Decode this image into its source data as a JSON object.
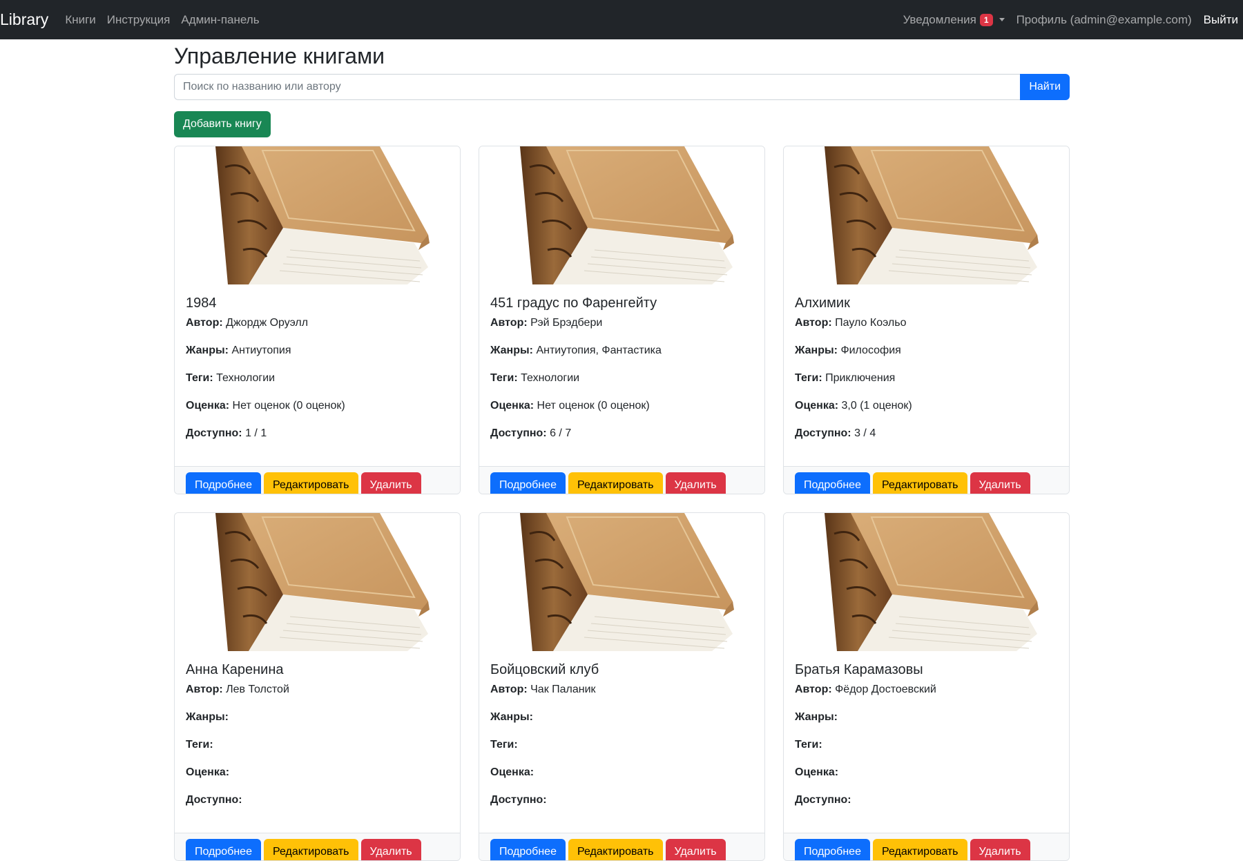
{
  "nav": {
    "brand": "Library",
    "links": [
      "Книги",
      "Инструкция",
      "Админ-панель"
    ],
    "notifications_label": "Уведомления",
    "notifications_count": "1",
    "profile": "Профиль (admin@example.com)",
    "logout": "Выйти"
  },
  "page": {
    "title": "Управление книгами",
    "search_placeholder": "Поиск по названию или автору",
    "search_button": "Найти",
    "add_button": "Добавить книгу"
  },
  "labels": {
    "author": "Автор:",
    "genres": "Жанры:",
    "tags": "Теги:",
    "rating": "Оценка:",
    "available": "Доступно:",
    "details": "Подробнее",
    "edit": "Редактировать",
    "delete": "Удалить"
  },
  "books": [
    {
      "title": "1984",
      "author": "Джордж Оруэлл",
      "genres": "Антиутопия",
      "tags": "Технологии",
      "rating": "Нет оценок (0 оценок)",
      "available": "1 / 1"
    },
    {
      "title": "451 градус по Фаренгейту",
      "author": "Рэй Брэдбери",
      "genres": "Антиутопия, Фантастика",
      "tags": "Технологии",
      "rating": "Нет оценок (0 оценок)",
      "available": "6 / 7"
    },
    {
      "title": "Алхимик",
      "author": "Пауло Коэльо",
      "genres": "Философия",
      "tags": "Приключения",
      "rating": "3,0 (1 оценок)",
      "available": "3 / 4"
    },
    {
      "title": "Анна Каренина",
      "author": "Лев Толстой",
      "genres": "",
      "tags": "",
      "rating": "",
      "available": ""
    },
    {
      "title": "Бойцовский клуб",
      "author": "Чак Паланик",
      "genres": "",
      "tags": "",
      "rating": "",
      "available": ""
    },
    {
      "title": "Братья Карамазовы",
      "author": "Фёдор Достоевский",
      "genres": "",
      "tags": "",
      "rating": "",
      "available": ""
    }
  ]
}
